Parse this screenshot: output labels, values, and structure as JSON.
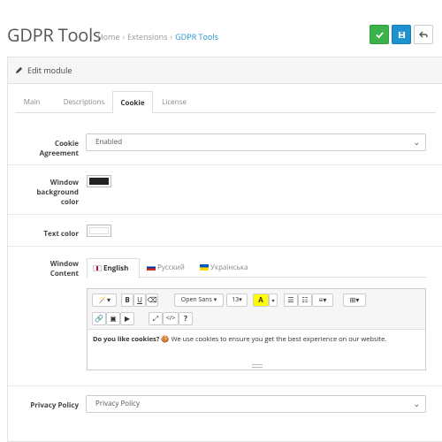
{
  "header": {
    "title": "GDPR Tools",
    "breadcrumb": [
      "Home",
      "Extensions",
      "GDPR Tools"
    ]
  },
  "panel": {
    "heading": "Edit module",
    "tabs": [
      "Main",
      "Descriptions",
      "Cookie",
      "License"
    ],
    "active_tab": "Cookie"
  },
  "form": {
    "cookie_agreement": {
      "label": "Cookie Agreement",
      "value": "Enabled"
    },
    "window_bg": {
      "label": "Window background color",
      "color": "#222222"
    },
    "text_color": {
      "label": "Text color",
      "color": "#ffffff"
    },
    "window_content": {
      "label": "Window Content",
      "languages": [
        "English",
        "Русский",
        "Українська"
      ],
      "active_language": "English",
      "toolbar": {
        "font": "Open Sans",
        "size": "13"
      },
      "text_bold": "Do you like cookies?",
      "text_rest": " 🍪 We use cookies to ensure you get the best experience on our website."
    },
    "privacy_policy": {
      "label": "Privacy Policy",
      "value": "Privacy Policy"
    }
  },
  "colors": {
    "accent": "#1e91cf",
    "success": "#3ab34a"
  }
}
